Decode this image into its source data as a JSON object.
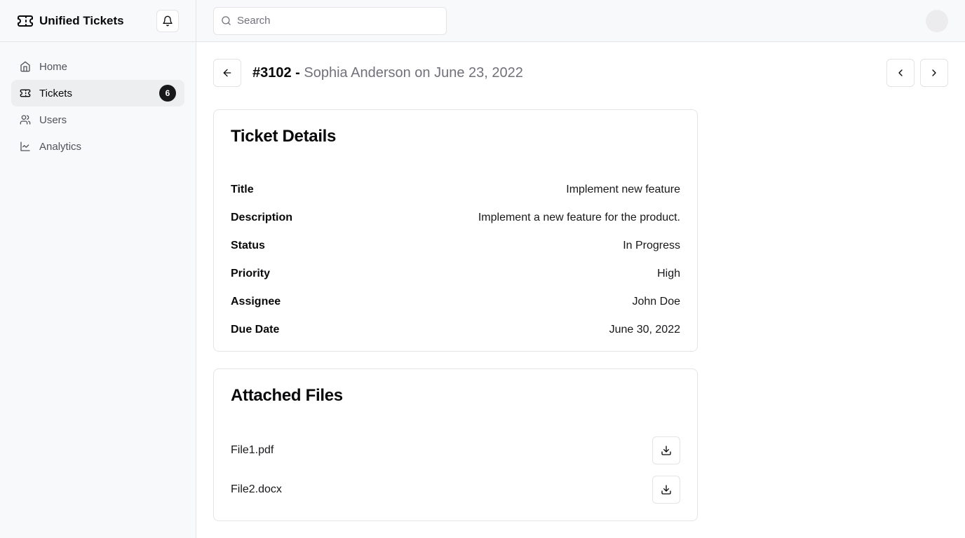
{
  "app": {
    "name": "Unified Tickets"
  },
  "icons": {
    "brand": "ticket-icon",
    "notifications": "bell-icon",
    "search": "search-icon",
    "back": "arrow-left-icon",
    "prev": "chevron-left-icon",
    "next": "chevron-right-icon",
    "download": "download-icon"
  },
  "sidebar": {
    "items": [
      {
        "label": "Home",
        "icon": "home-icon",
        "active": false
      },
      {
        "label": "Tickets",
        "icon": "ticket-icon",
        "active": true,
        "badge": "6"
      },
      {
        "label": "Users",
        "icon": "users-icon",
        "active": false
      },
      {
        "label": "Analytics",
        "icon": "line-chart-icon",
        "active": false
      }
    ]
  },
  "search": {
    "placeholder": "Search",
    "value": ""
  },
  "ticket": {
    "number": "#3102 -",
    "subtitle": "Sophia Anderson on June 23, 2022"
  },
  "details": {
    "heading": "Ticket Details",
    "rows": [
      {
        "key": "Title",
        "value": "Implement new feature"
      },
      {
        "key": "Description",
        "value": "Implement a new feature for the product."
      },
      {
        "key": "Status",
        "value": "In Progress"
      },
      {
        "key": "Priority",
        "value": "High"
      },
      {
        "key": "Assignee",
        "value": "John Doe"
      },
      {
        "key": "Due Date",
        "value": "June 30, 2022"
      }
    ]
  },
  "files": {
    "heading": "Attached Files",
    "items": [
      {
        "name": "File1.pdf"
      },
      {
        "name": "File2.docx"
      }
    ]
  },
  "colors": {
    "sidebar_bg": "#f8f9fa",
    "border": "#e4e4e7",
    "badge_bg": "#18181b",
    "muted_text": "#71717a"
  }
}
